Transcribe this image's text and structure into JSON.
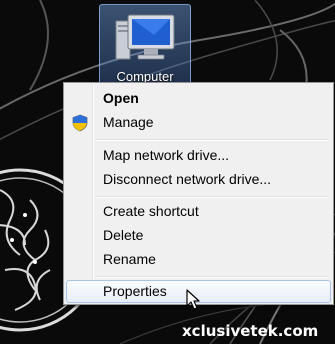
{
  "desktop_icon": {
    "label": "Computer",
    "icon": "computer-icon"
  },
  "context_menu": {
    "items": [
      {
        "label": "Open",
        "bold": true
      },
      {
        "label": "Manage",
        "icon": "uac-shield-icon"
      },
      {
        "label": "Map network drive..."
      },
      {
        "label": "Disconnect network drive..."
      },
      {
        "label": "Create shortcut"
      },
      {
        "label": "Delete"
      },
      {
        "label": "Rename"
      },
      {
        "label": "Properties",
        "highlighted": true
      }
    ]
  },
  "watermark": "xclusivetek.com",
  "colors": {
    "menu_bg": "#f0f0f0",
    "highlight_border": "#a8c4e8",
    "desktop_bg": "#0a0a0a"
  }
}
